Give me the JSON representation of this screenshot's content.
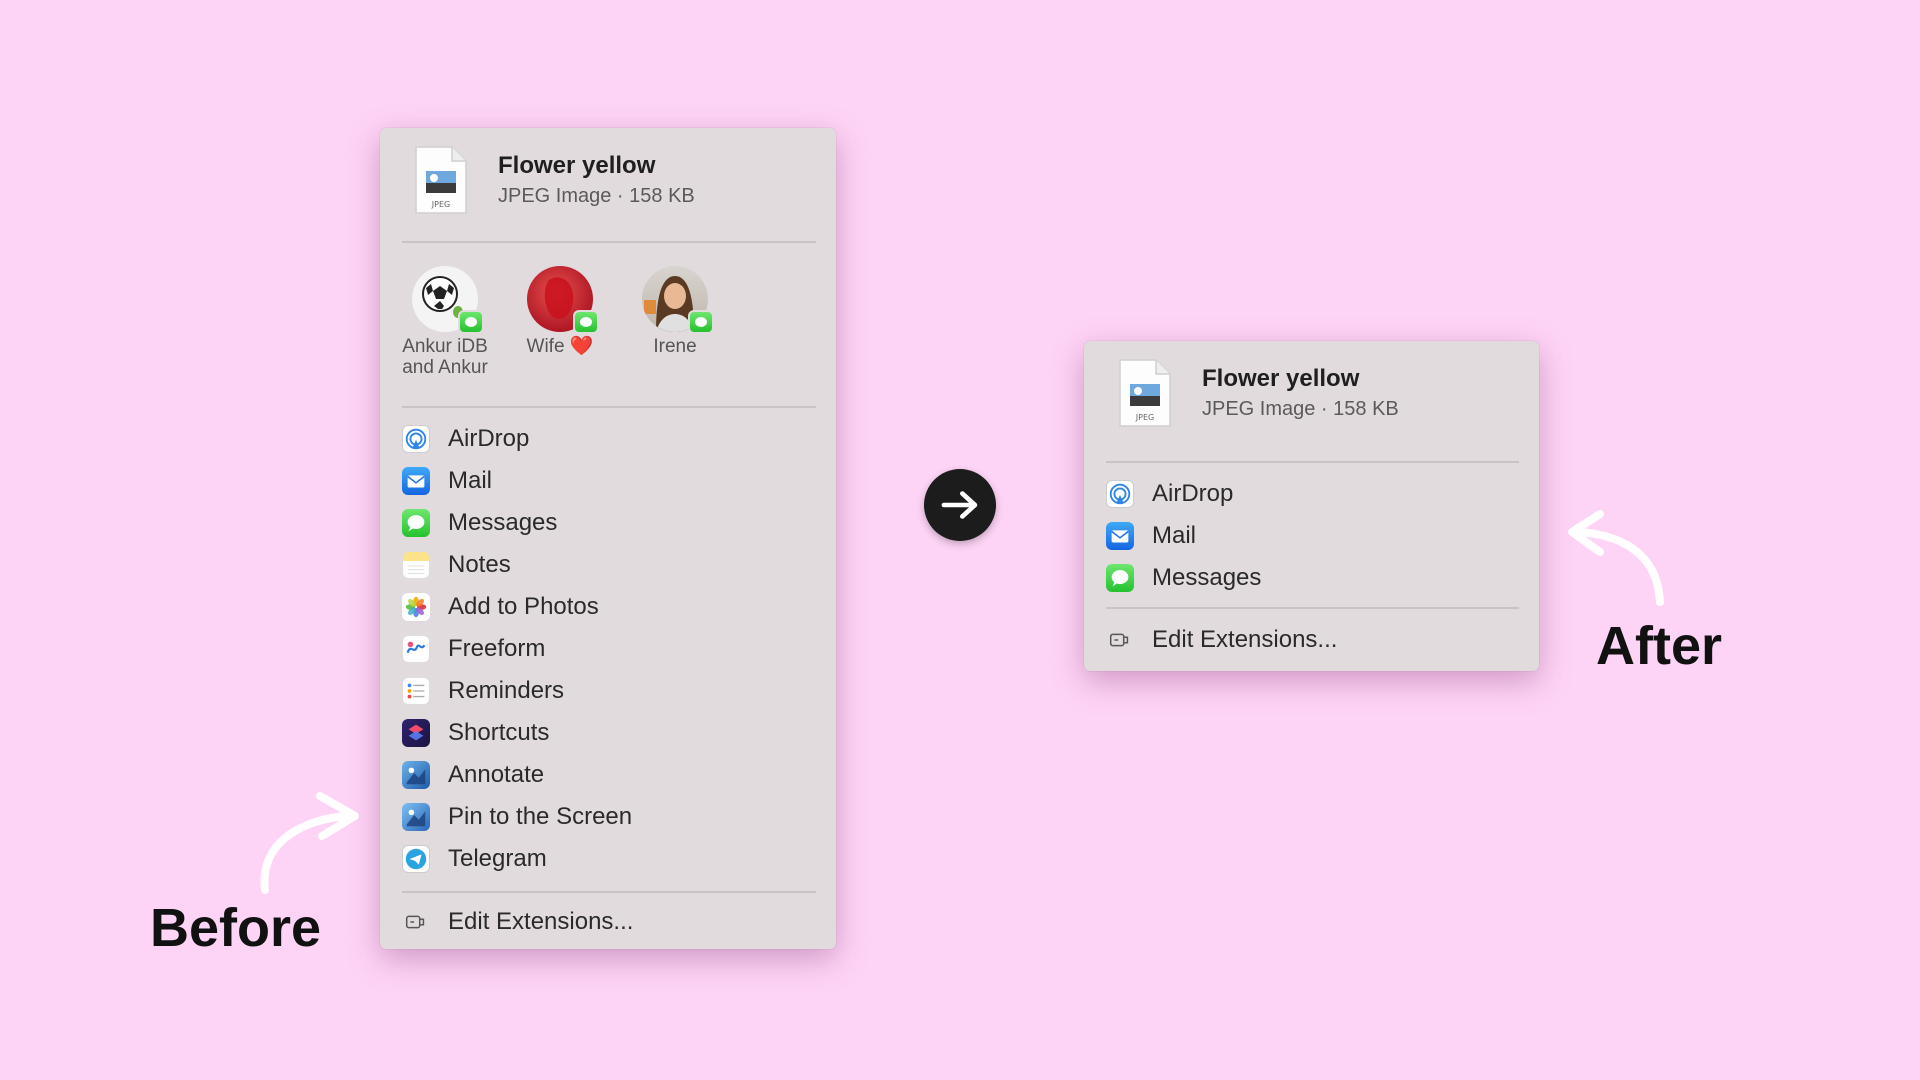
{
  "file": {
    "title": "Flower yellow",
    "meta": "JPEG Image · 158 KB",
    "icon_label": "JPEG"
  },
  "before": {
    "caption": "Before",
    "people": [
      {
        "name_line1": "Ankur iDB",
        "name_line2": "and Ankur",
        "avatar": "soccer-ball-avatar"
      },
      {
        "name_line1": "Wife ❤️",
        "name_line2": "",
        "avatar": "red-avatar"
      },
      {
        "name_line1": "Irene",
        "name_line2": "",
        "avatar": "woman-photo-avatar"
      }
    ],
    "items": [
      {
        "label": "AirDrop",
        "icon": "airdrop-icon"
      },
      {
        "label": "Mail",
        "icon": "mail-icon"
      },
      {
        "label": "Messages",
        "icon": "messages-icon"
      },
      {
        "label": "Notes",
        "icon": "notes-icon"
      },
      {
        "label": "Add to Photos",
        "icon": "photos-icon"
      },
      {
        "label": "Freeform",
        "icon": "freeform-icon"
      },
      {
        "label": "Reminders",
        "icon": "reminders-icon"
      },
      {
        "label": "Shortcuts",
        "icon": "shortcuts-icon"
      },
      {
        "label": "Annotate",
        "icon": "annotate-icon"
      },
      {
        "label": "Pin to the Screen",
        "icon": "pin-icon"
      },
      {
        "label": "Telegram",
        "icon": "telegram-icon"
      }
    ],
    "edit_extensions": "Edit Extensions..."
  },
  "after": {
    "caption": "After",
    "items": [
      {
        "label": "AirDrop",
        "icon": "airdrop-icon"
      },
      {
        "label": "Mail",
        "icon": "mail-icon"
      },
      {
        "label": "Messages",
        "icon": "messages-icon"
      }
    ],
    "edit_extensions": "Edit Extensions..."
  },
  "colors": {
    "background": "#fed4f6",
    "menu": "#e2dbde",
    "arrow_button": "#1c1c1c"
  }
}
